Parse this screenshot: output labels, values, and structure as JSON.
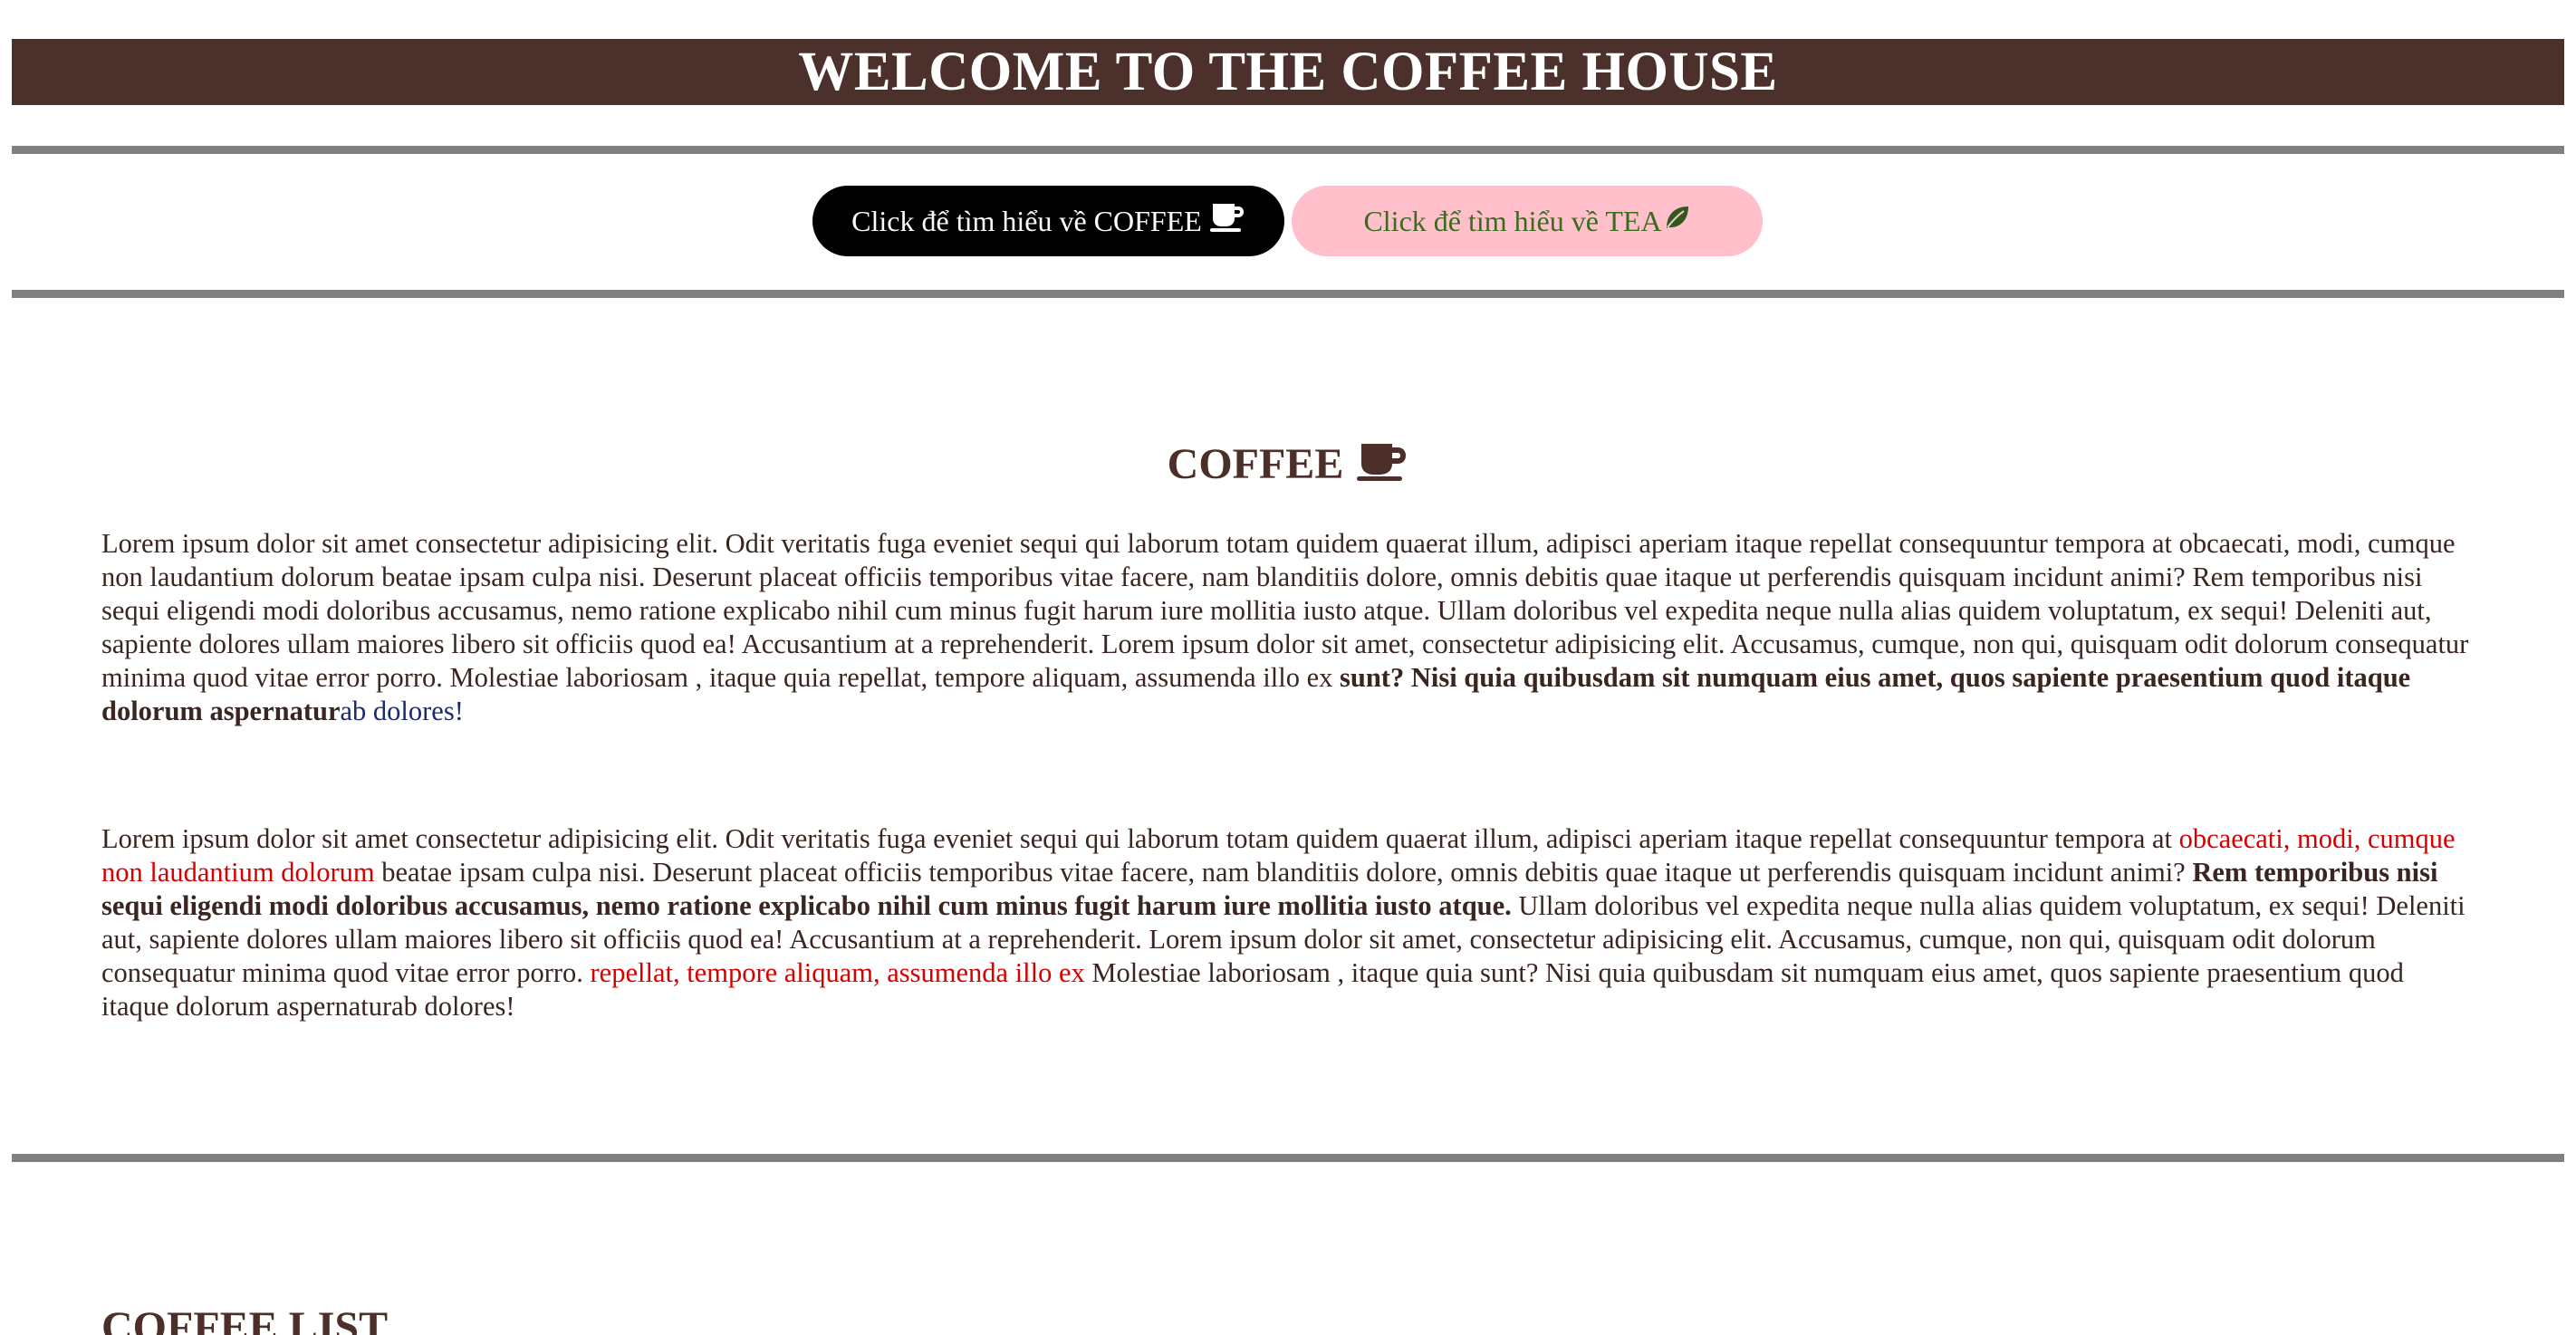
{
  "header": {
    "title": "WELCOME TO THE COFFEE HOUSE"
  },
  "buttons": {
    "coffee_label": "Click để tìm hiểu về COFFEE",
    "coffee_icon": "coffee-cup-icon",
    "tea_label": "Click để tìm hiểu về TEA",
    "tea_icon": "leaf-icon"
  },
  "coffee_section": {
    "title": "COFFEE",
    "title_icon": "coffee-cup-icon",
    "paragraph1": {
      "text": "Lorem ipsum dolor sit amet consectetur adipisicing elit. Odit veritatis fuga eveniet sequi qui laborum totam quidem quaerat illum, adipisci aperiam itaque repellat consequuntur tempora at obcaecati, modi, cumque non laudantium dolorum beatae ipsam culpa nisi. Deserunt placeat officiis temporibus vitae facere, nam blanditiis dolore, omnis debitis quae itaque ut perferendis quisquam incidunt animi? Rem temporibus nisi sequi eligendi modi doloribus accusamus, nemo ratione explicabo nihil cum minus fugit harum iure mollitia iusto atque. Ullam doloribus vel expedita neque nulla alias quidem voluptatum, ex sequi! Deleniti aut, sapiente dolores ullam maiores libero sit officiis quod ea! Accusantium at a reprehenderit. Lorem ipsum dolor sit amet, consectetur adipisicing elit. Accusamus, cumque, non qui, quisquam odit dolorum consequatur minima quod vitae error porro. Molestiae laboriosam , itaque quia repellat, tempore aliquam, assumenda illo ex ",
      "bold": "sunt? Nisi quia quibusdam sit numquam eius amet, quos sapiente praesentium quod itaque dolorum aspernatur",
      "link": "ab dolores!"
    },
    "paragraph2": {
      "text1": "Lorem ipsum dolor sit amet consectetur adipisicing elit. Odit veritatis fuga eveniet sequi qui laborum totam quidem quaerat illum, adipisci aperiam itaque repellat consequuntur tempora at ",
      "red1": "obcaecati, modi, cumque non laudantium dolorum",
      "text2": " beatae ipsam culpa nisi. Deserunt placeat officiis temporibus vitae facere, nam blanditiis dolore, omnis debitis quae itaque ut perferendis quisquam incidunt animi? ",
      "bold": "Rem temporibus nisi sequi eligendi modi doloribus accusamus, nemo ratione explicabo nihil cum minus fugit harum iure mollitia iusto atque.",
      "text3": " Ullam doloribus vel expedita neque nulla alias quidem voluptatum, ex sequi! Deleniti aut, sapiente dolores ullam maiores libero sit officiis quod ea! Accusantium at a reprehenderit. Lorem ipsum dolor sit amet, consectetur adipisicing elit. Accusamus, cumque, non qui, quisquam odit dolorum consequatur minima quod vitae error porro. ",
      "red2": "repellat, tempore aliquam, assumenda illo ex",
      "text4": " Molestiae laboriosam , itaque quia sunt? Nisi quia quibusdam sit numquam eius amet, quos sapiente praesentium quod itaque dolorum aspernaturab dolores!"
    }
  },
  "coffee_list": {
    "title": "COFFEE LIST"
  },
  "colors": {
    "banner_bg": "#4b302b",
    "rule": "#808080",
    "coffee_button_bg": "#000000",
    "tea_button_bg": "#ffc0cb",
    "tea_button_text": "#3b6b1f",
    "heading_text": "#4b2f28",
    "link_text": "#1a2a6c",
    "highlight_red": "#d50000"
  }
}
